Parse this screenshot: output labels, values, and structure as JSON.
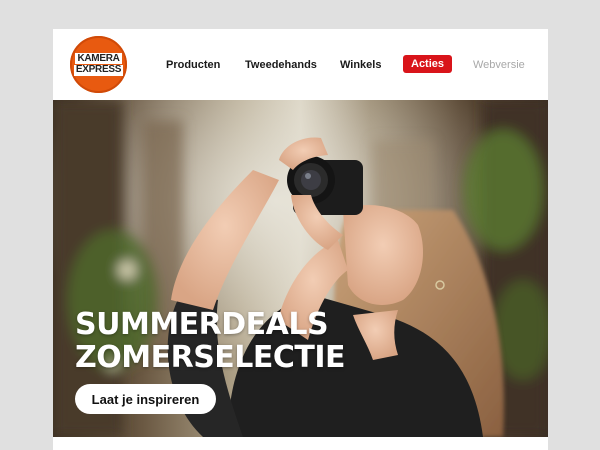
{
  "logo": {
    "line1": "KAMERA",
    "line2": "EXPRESS"
  },
  "nav": {
    "items": [
      "Producten",
      "Tweedehands",
      "Winkels"
    ],
    "acties": "Acties",
    "webversie": "Webversie"
  },
  "hero": {
    "title_line1": "SUMMERDEALS",
    "title_line2": "ZOMERSELECTIE",
    "cta": "Laat je inspireren"
  },
  "colors": {
    "brand_orange": "#e85a10",
    "acties_red": "#d9141a",
    "page_bg": "#e0e0e0"
  }
}
